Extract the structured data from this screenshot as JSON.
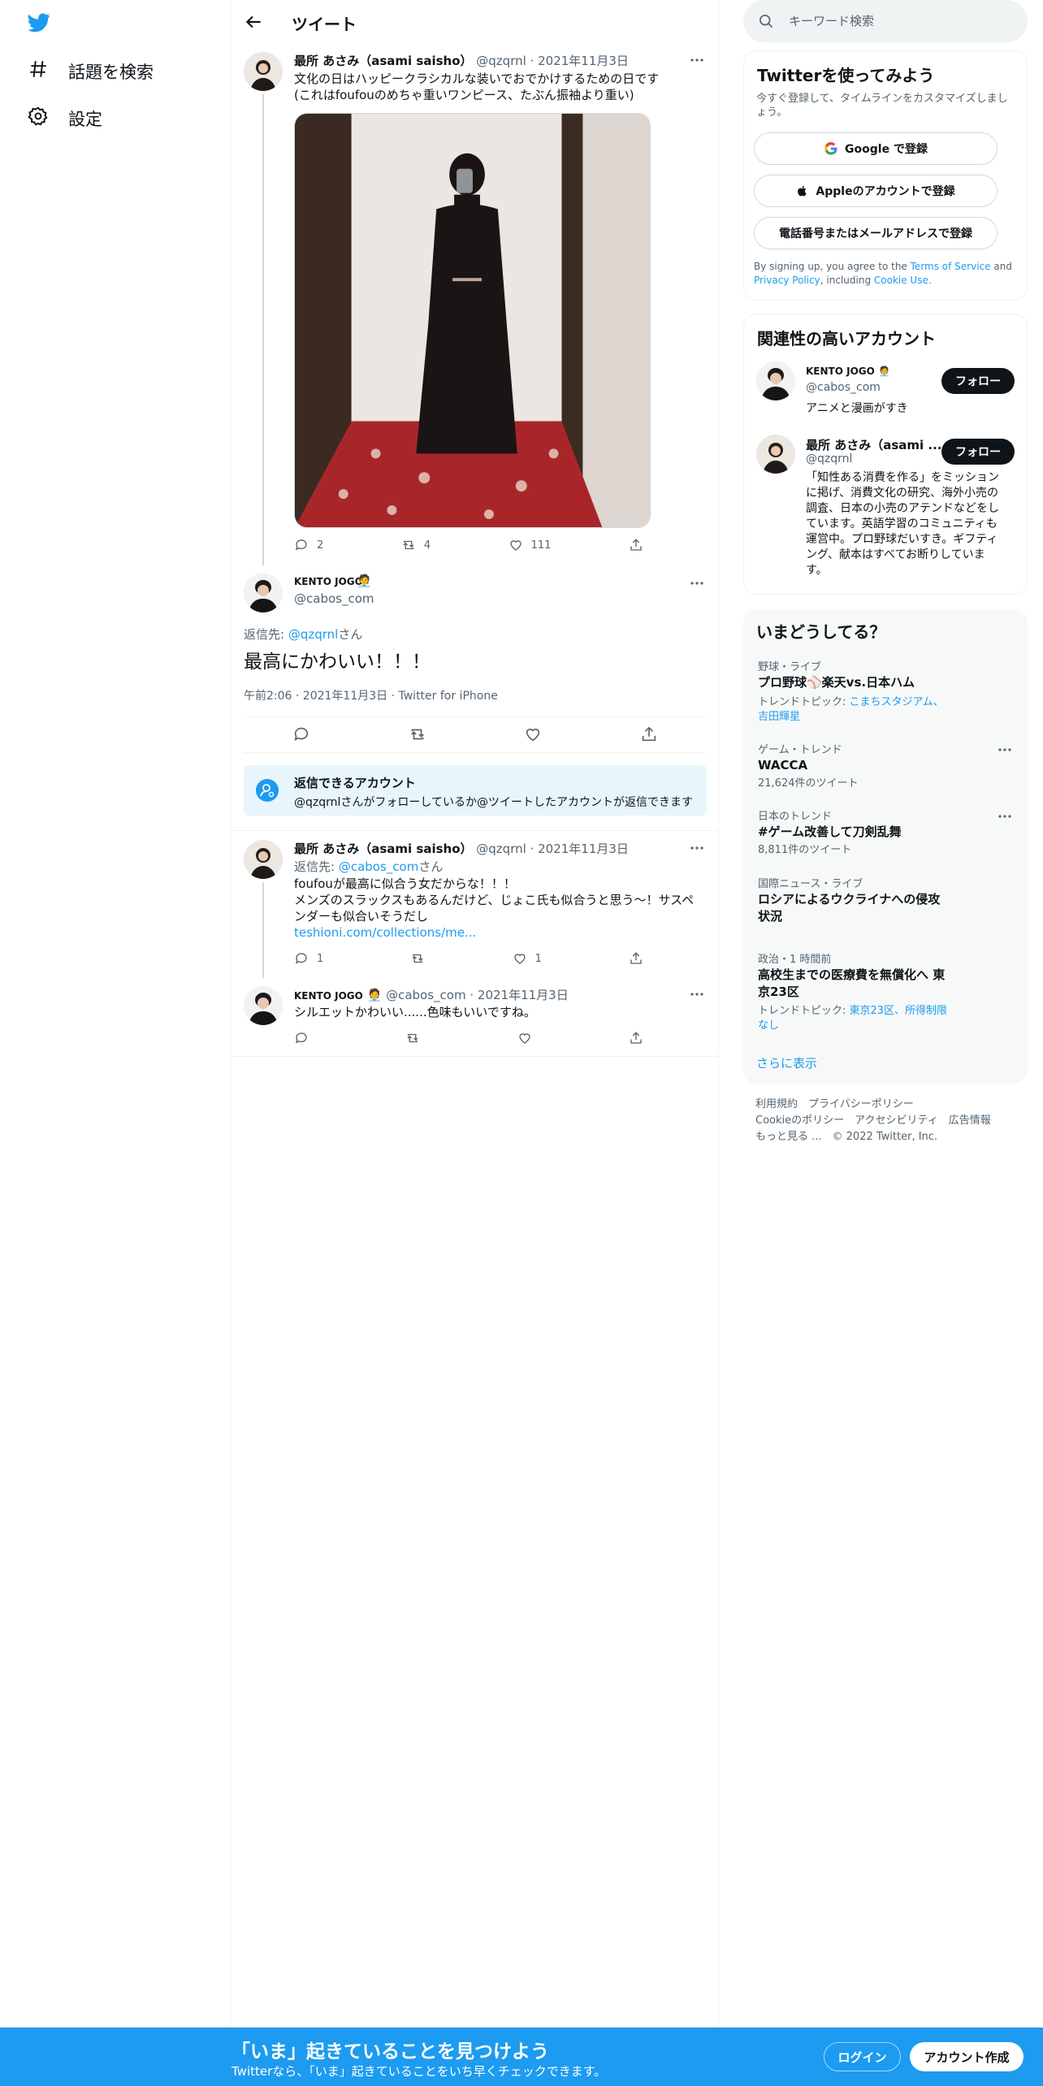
{
  "nav": {
    "items": [
      {
        "label": "話題を検索",
        "icon": "hashtag-icon"
      },
      {
        "label": "設定",
        "icon": "gear-icon"
      }
    ]
  },
  "header": {
    "title": "ツイート"
  },
  "tweet1": {
    "name": "最所 あさみ（asami saisho）",
    "handle": "@qzqrnl",
    "date": "2021年11月3日",
    "text1": "文化の日はハッピークラシカルな装いでおでかけするための日です",
    "text2": "(これはfoufouのめちゃ重いワンピース、たぶん振袖より重い)",
    "replies": "2",
    "retweets": "4",
    "likes": "111"
  },
  "focus": {
    "name": "KENTO JOGO",
    "handle": "@cabos_com",
    "reply_to_label": "返信先: ",
    "reply_to_handle": "@qzqrnl",
    "reply_to_suffix": "さん",
    "text": "最高にかわいい！！！",
    "meta": "午前2:06 · 2021年11月3日 · Twitter for iPhone"
  },
  "notice": {
    "title": "返信できるアカウント",
    "text": "@qzqrnlさんがフォローしているか@ツイートしたアカウントが返信できます"
  },
  "tweet3": {
    "name": "最所 あさみ（asami saisho）",
    "handle": "@qzqrnl",
    "date": "2021年11月3日",
    "reply_to_label": "返信先: ",
    "reply_to_handle": "@cabos_com",
    "reply_to_suffix": "さん",
    "line1": "foufouが最高に似合う女だからな！！！",
    "line2": "メンズのスラックスもあるんだけど、じょこ氏も似合うと思う〜！サスペ",
    "line3": "ンダーも似合いそうだし",
    "link": "teshioni.com/collections/me...",
    "replies": "1",
    "likes": "1"
  },
  "tweet4": {
    "name": "KENTO JOGO",
    "handle": "@cabos_com",
    "date": "2021年11月3日",
    "text": "シルエットかわいい......色味もいいですね。"
  },
  "search": {
    "placeholder": "キーワード検索"
  },
  "signup": {
    "title": "Twitterを使ってみよう",
    "subtitle": "今すぐ登録して、タイムラインをカスタマイズしましょう。",
    "google": "Google で登録",
    "apple": "Appleのアカウントで登録",
    "phone": "電話番号またはメールアドレスで登録",
    "legal_prefix": "By signing up, you agree to the ",
    "terms": "Terms of Service",
    "and": " and",
    "privacy": "Privacy Policy",
    "including": ", including ",
    "cookie": "Cookie Use."
  },
  "relevant": {
    "title": "関連性の高いアカウント",
    "accounts": [
      {
        "name": "KENTO JOGO",
        "handle": "@cabos_com",
        "bio": "アニメと漫画がすき",
        "button": "フォロー"
      },
      {
        "name": "最所 あさみ（asami ...",
        "handle": "@qzqrnl",
        "bio1": "「知性ある消費を作る」をミッション",
        "bio2": "に掲げ、消費文化の研究、海外小売の",
        "bio3": "調査、日本の小売のアテンドなどをし",
        "bio4": "ています。英語学習のコミュニティも",
        "bio5": "運営中。プロ野球だいすき。ギフティ",
        "bio6": "ング、献本はすべてお断りしていま",
        "bio7": "す。",
        "button": "フォロー"
      }
    ]
  },
  "trends": {
    "title": "いまどうしてる？",
    "items": [
      {
        "category": "野球・ライブ",
        "name": "プロ野球⚾楽天vs.日本ハム",
        "meta_label": "トレンドトピック: ",
        "meta_link1": "こまちスタジアム、",
        "meta_link2": "吉田輝星"
      },
      {
        "category": "ゲーム・トレンド",
        "name": "WACCA",
        "meta": "21,624件のツイート"
      },
      {
        "category": "日本のトレンド",
        "name": "#ゲーム改善して刀剣乱舞",
        "meta": "8,811件のツイート"
      },
      {
        "category": "国際ニュース・ライブ",
        "name1": "ロシアによるウクライナへの侵攻",
        "name2": "状況"
      },
      {
        "category": "政治・1 時間前",
        "name1": "高校生までの医療費を無償化へ 東",
        "name2": "京23区",
        "meta_label": "トレンドトピック: ",
        "meta_link1": "東京23区、所得制限",
        "meta_link2": "なし"
      }
    ],
    "more": "さらに表示"
  },
  "footer": {
    "line1": "利用規約　プライバシーポリシー",
    "line2": "Cookieのポリシー　アクセシビリティ　広告情報",
    "line3": "もっと見る ...　© 2022 Twitter, Inc."
  },
  "bottombar": {
    "title": "「いま」起きていることを見つけよう",
    "subtitle": "Twitterなら、「いま」起きていることをいち早くチェックできます。",
    "login": "ログイン",
    "signup": "アカウント作成"
  },
  "colors": {
    "accent": "#1d9bf0",
    "text": "#0f1419",
    "muted": "#536471",
    "border": "#eff3f4"
  }
}
